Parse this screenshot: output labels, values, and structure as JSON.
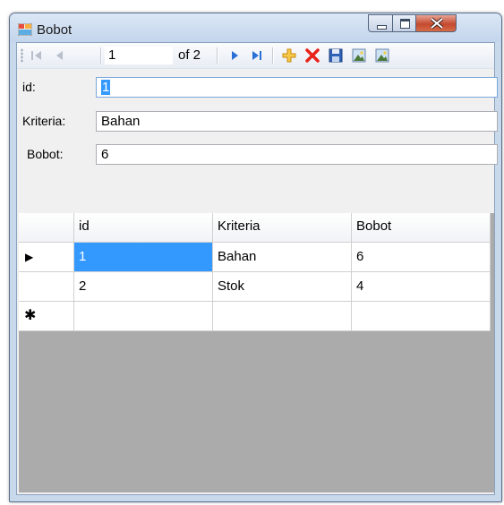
{
  "window": {
    "title": "Bobot"
  },
  "navigator": {
    "position": "1",
    "count_label": "of 2"
  },
  "fields": [
    {
      "label": "id:",
      "value": "1"
    },
    {
      "label": "Kriteria:",
      "value": "Bahan"
    },
    {
      "label": "Bobot:",
      "value": "6"
    }
  ],
  "grid": {
    "columns": [
      "id",
      "Kriteria",
      "Bobot"
    ],
    "rows": [
      {
        "id": "1",
        "kriteria": "Bahan",
        "bobot": "6"
      },
      {
        "id": "2",
        "kriteria": "Stok",
        "bobot": "4"
      }
    ],
    "new_row_marker": "✱",
    "current_row_marker": "▶"
  },
  "colors": {
    "selection": "#3399ff",
    "grid_background": "#ababab",
    "title_bar": "#c9d9ec"
  }
}
